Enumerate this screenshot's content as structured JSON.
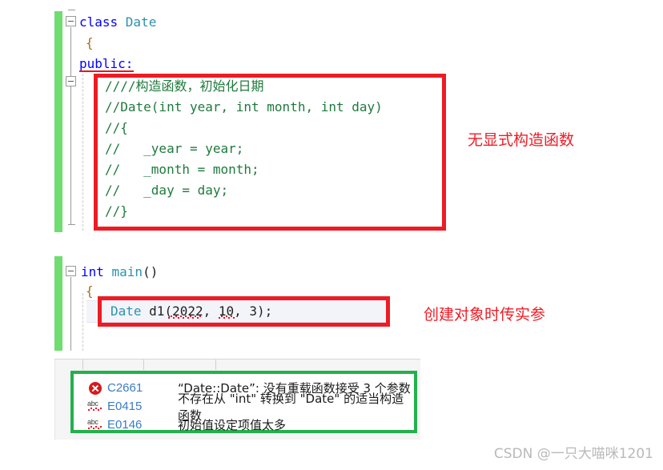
{
  "editor": {
    "code_lines": [
      {
        "id": "l1",
        "text": "class Date",
        "tokens": [
          {
            "t": "class ",
            "c": "kw"
          },
          {
            "t": "Date",
            "c": "type"
          }
        ]
      },
      {
        "id": "l2",
        "text": "{"
      },
      {
        "id": "l3",
        "text": "public:"
      },
      {
        "id": "l4",
        "text": "////构造函数，初始化日期"
      },
      {
        "id": "l5",
        "text": "//Date(int year, int month, int day)"
      },
      {
        "id": "l6",
        "text": "//{"
      },
      {
        "id": "l7",
        "text": "//   _year = year;"
      },
      {
        "id": "l8",
        "text": "//   _month = month;"
      },
      {
        "id": "l9",
        "text": "//   _day = day;"
      },
      {
        "id": "l10",
        "text": "//}"
      },
      {
        "id": "l11",
        "text": "int main()"
      },
      {
        "id": "l12",
        "text": "{"
      },
      {
        "id": "l13",
        "text": "Date d1(2022, 10, 3);"
      }
    ],
    "main_keyword": "int ",
    "main_name": "main",
    "main_parens": "()",
    "decl_type": "Date ",
    "decl_rest": "d1(2022, 10, 3);",
    "public_label": "public:",
    "open_brace": "{"
  },
  "annotations": [
    {
      "id": "a1",
      "text": "无显式构造函数",
      "color": "#ee1c25"
    },
    {
      "id": "a2",
      "text": "创建对象时传实参",
      "color": "#ee1c25"
    }
  ],
  "highlight_boxes": {
    "comment_block_color": "#ed1c24",
    "declaration_color": "#ed1c24",
    "error_list_color": "#22b14c"
  },
  "error_list": {
    "rows": [
      {
        "icon": "error-circle-icon",
        "code": "C2661",
        "description": "“Date::Date”: 没有重载函数接受 3 个参数"
      },
      {
        "icon": "abc-squiggle-icon",
        "code": "E0415",
        "description": "不存在从 \"int\" 转换到 \"Date\" 的适当构造函数"
      },
      {
        "icon": "abc-squiggle-icon",
        "code": "E0146",
        "description": "初始值设定项值太多"
      }
    ]
  },
  "watermark": {
    "text": "CSDN @一只大喵咪1201"
  },
  "colors": {
    "keyword": "#0000ff",
    "type": "#2b91af",
    "comment": "#1f7a3d",
    "changebar": "#6fdd6f",
    "error_red": "#ed1c24",
    "ok_green": "#22b14c",
    "code_link": "#3a7cc4"
  }
}
